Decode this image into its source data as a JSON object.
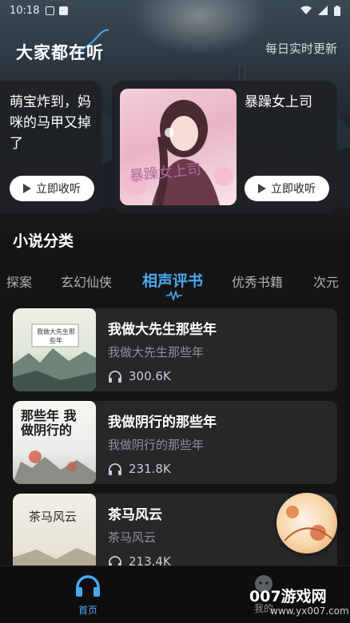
{
  "status_bar": {
    "time": "10:18"
  },
  "hero": {
    "title": "大家都在听",
    "right_label": "每日实时更新",
    "cards": [
      {
        "title": "萌宝炸到，妈咪的马甲又掉了",
        "button": "立即收听"
      },
      {
        "title": "暴躁女上司",
        "button": "立即收听",
        "cover_text": "暴躁女上司"
      }
    ]
  },
  "section": {
    "title": "小说分类"
  },
  "tabs": [
    {
      "label": "探案"
    },
    {
      "label": "玄幻仙侠"
    },
    {
      "label": "相声评书",
      "active": true
    },
    {
      "label": "优秀书籍"
    },
    {
      "label": "次元"
    }
  ],
  "items": [
    {
      "title": "我做大先生那些年",
      "subtitle": "我做大先生那些年",
      "plays": "300.6K",
      "cover_text": "我做大先生那些年"
    },
    {
      "title": "我做阴行的那些年",
      "subtitle": "我做阴行的那些年",
      "plays": "231.8K",
      "cover_text": "那些年 我做阴行的"
    },
    {
      "title": "茶马风云",
      "subtitle": "茶马风云",
      "plays": "213.4K",
      "cover_text": "茶马风云"
    }
  ],
  "bottom_nav": {
    "home": "首页",
    "mine": "我的"
  },
  "watermark": {
    "brand": "007游戏网",
    "url": "www.yx007.com"
  },
  "colors": {
    "accent": "#4aa8f0",
    "background": "#141414",
    "card": "#262729"
  }
}
